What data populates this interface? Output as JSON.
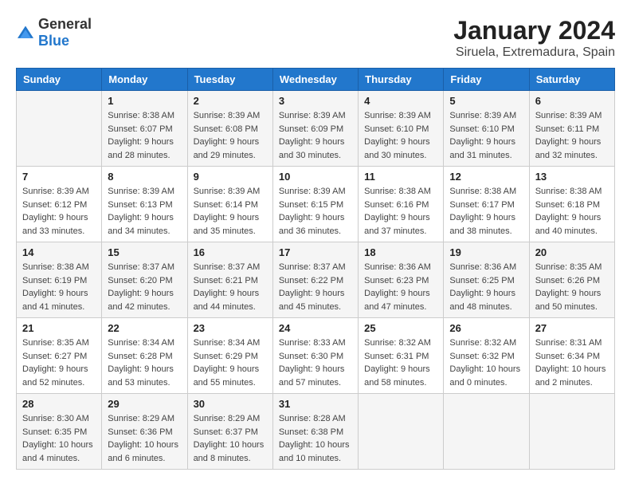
{
  "logo": {
    "general": "General",
    "blue": "Blue"
  },
  "title": "January 2024",
  "location": "Siruela, Extremadura, Spain",
  "headers": [
    "Sunday",
    "Monday",
    "Tuesday",
    "Wednesday",
    "Thursday",
    "Friday",
    "Saturday"
  ],
  "weeks": [
    [
      {
        "day": "",
        "sunrise": "",
        "sunset": "",
        "daylight": ""
      },
      {
        "day": "1",
        "sunrise": "Sunrise: 8:38 AM",
        "sunset": "Sunset: 6:07 PM",
        "daylight": "Daylight: 9 hours and 28 minutes."
      },
      {
        "day": "2",
        "sunrise": "Sunrise: 8:39 AM",
        "sunset": "Sunset: 6:08 PM",
        "daylight": "Daylight: 9 hours and 29 minutes."
      },
      {
        "day": "3",
        "sunrise": "Sunrise: 8:39 AM",
        "sunset": "Sunset: 6:09 PM",
        "daylight": "Daylight: 9 hours and 30 minutes."
      },
      {
        "day": "4",
        "sunrise": "Sunrise: 8:39 AM",
        "sunset": "Sunset: 6:10 PM",
        "daylight": "Daylight: 9 hours and 30 minutes."
      },
      {
        "day": "5",
        "sunrise": "Sunrise: 8:39 AM",
        "sunset": "Sunset: 6:10 PM",
        "daylight": "Daylight: 9 hours and 31 minutes."
      },
      {
        "day": "6",
        "sunrise": "Sunrise: 8:39 AM",
        "sunset": "Sunset: 6:11 PM",
        "daylight": "Daylight: 9 hours and 32 minutes."
      }
    ],
    [
      {
        "day": "7",
        "sunrise": "Sunrise: 8:39 AM",
        "sunset": "Sunset: 6:12 PM",
        "daylight": "Daylight: 9 hours and 33 minutes."
      },
      {
        "day": "8",
        "sunrise": "Sunrise: 8:39 AM",
        "sunset": "Sunset: 6:13 PM",
        "daylight": "Daylight: 9 hours and 34 minutes."
      },
      {
        "day": "9",
        "sunrise": "Sunrise: 8:39 AM",
        "sunset": "Sunset: 6:14 PM",
        "daylight": "Daylight: 9 hours and 35 minutes."
      },
      {
        "day": "10",
        "sunrise": "Sunrise: 8:39 AM",
        "sunset": "Sunset: 6:15 PM",
        "daylight": "Daylight: 9 hours and 36 minutes."
      },
      {
        "day": "11",
        "sunrise": "Sunrise: 8:38 AM",
        "sunset": "Sunset: 6:16 PM",
        "daylight": "Daylight: 9 hours and 37 minutes."
      },
      {
        "day": "12",
        "sunrise": "Sunrise: 8:38 AM",
        "sunset": "Sunset: 6:17 PM",
        "daylight": "Daylight: 9 hours and 38 minutes."
      },
      {
        "day": "13",
        "sunrise": "Sunrise: 8:38 AM",
        "sunset": "Sunset: 6:18 PM",
        "daylight": "Daylight: 9 hours and 40 minutes."
      }
    ],
    [
      {
        "day": "14",
        "sunrise": "Sunrise: 8:38 AM",
        "sunset": "Sunset: 6:19 PM",
        "daylight": "Daylight: 9 hours and 41 minutes."
      },
      {
        "day": "15",
        "sunrise": "Sunrise: 8:37 AM",
        "sunset": "Sunset: 6:20 PM",
        "daylight": "Daylight: 9 hours and 42 minutes."
      },
      {
        "day": "16",
        "sunrise": "Sunrise: 8:37 AM",
        "sunset": "Sunset: 6:21 PM",
        "daylight": "Daylight: 9 hours and 44 minutes."
      },
      {
        "day": "17",
        "sunrise": "Sunrise: 8:37 AM",
        "sunset": "Sunset: 6:22 PM",
        "daylight": "Daylight: 9 hours and 45 minutes."
      },
      {
        "day": "18",
        "sunrise": "Sunrise: 8:36 AM",
        "sunset": "Sunset: 6:23 PM",
        "daylight": "Daylight: 9 hours and 47 minutes."
      },
      {
        "day": "19",
        "sunrise": "Sunrise: 8:36 AM",
        "sunset": "Sunset: 6:25 PM",
        "daylight": "Daylight: 9 hours and 48 minutes."
      },
      {
        "day": "20",
        "sunrise": "Sunrise: 8:35 AM",
        "sunset": "Sunset: 6:26 PM",
        "daylight": "Daylight: 9 hours and 50 minutes."
      }
    ],
    [
      {
        "day": "21",
        "sunrise": "Sunrise: 8:35 AM",
        "sunset": "Sunset: 6:27 PM",
        "daylight": "Daylight: 9 hours and 52 minutes."
      },
      {
        "day": "22",
        "sunrise": "Sunrise: 8:34 AM",
        "sunset": "Sunset: 6:28 PM",
        "daylight": "Daylight: 9 hours and 53 minutes."
      },
      {
        "day": "23",
        "sunrise": "Sunrise: 8:34 AM",
        "sunset": "Sunset: 6:29 PM",
        "daylight": "Daylight: 9 hours and 55 minutes."
      },
      {
        "day": "24",
        "sunrise": "Sunrise: 8:33 AM",
        "sunset": "Sunset: 6:30 PM",
        "daylight": "Daylight: 9 hours and 57 minutes."
      },
      {
        "day": "25",
        "sunrise": "Sunrise: 8:32 AM",
        "sunset": "Sunset: 6:31 PM",
        "daylight": "Daylight: 9 hours and 58 minutes."
      },
      {
        "day": "26",
        "sunrise": "Sunrise: 8:32 AM",
        "sunset": "Sunset: 6:32 PM",
        "daylight": "Daylight: 10 hours and 0 minutes."
      },
      {
        "day": "27",
        "sunrise": "Sunrise: 8:31 AM",
        "sunset": "Sunset: 6:34 PM",
        "daylight": "Daylight: 10 hours and 2 minutes."
      }
    ],
    [
      {
        "day": "28",
        "sunrise": "Sunrise: 8:30 AM",
        "sunset": "Sunset: 6:35 PM",
        "daylight": "Daylight: 10 hours and 4 minutes."
      },
      {
        "day": "29",
        "sunrise": "Sunrise: 8:29 AM",
        "sunset": "Sunset: 6:36 PM",
        "daylight": "Daylight: 10 hours and 6 minutes."
      },
      {
        "day": "30",
        "sunrise": "Sunrise: 8:29 AM",
        "sunset": "Sunset: 6:37 PM",
        "daylight": "Daylight: 10 hours and 8 minutes."
      },
      {
        "day": "31",
        "sunrise": "Sunrise: 8:28 AM",
        "sunset": "Sunset: 6:38 PM",
        "daylight": "Daylight: 10 hours and 10 minutes."
      },
      {
        "day": "",
        "sunrise": "",
        "sunset": "",
        "daylight": ""
      },
      {
        "day": "",
        "sunrise": "",
        "sunset": "",
        "daylight": ""
      },
      {
        "day": "",
        "sunrise": "",
        "sunset": "",
        "daylight": ""
      }
    ]
  ]
}
